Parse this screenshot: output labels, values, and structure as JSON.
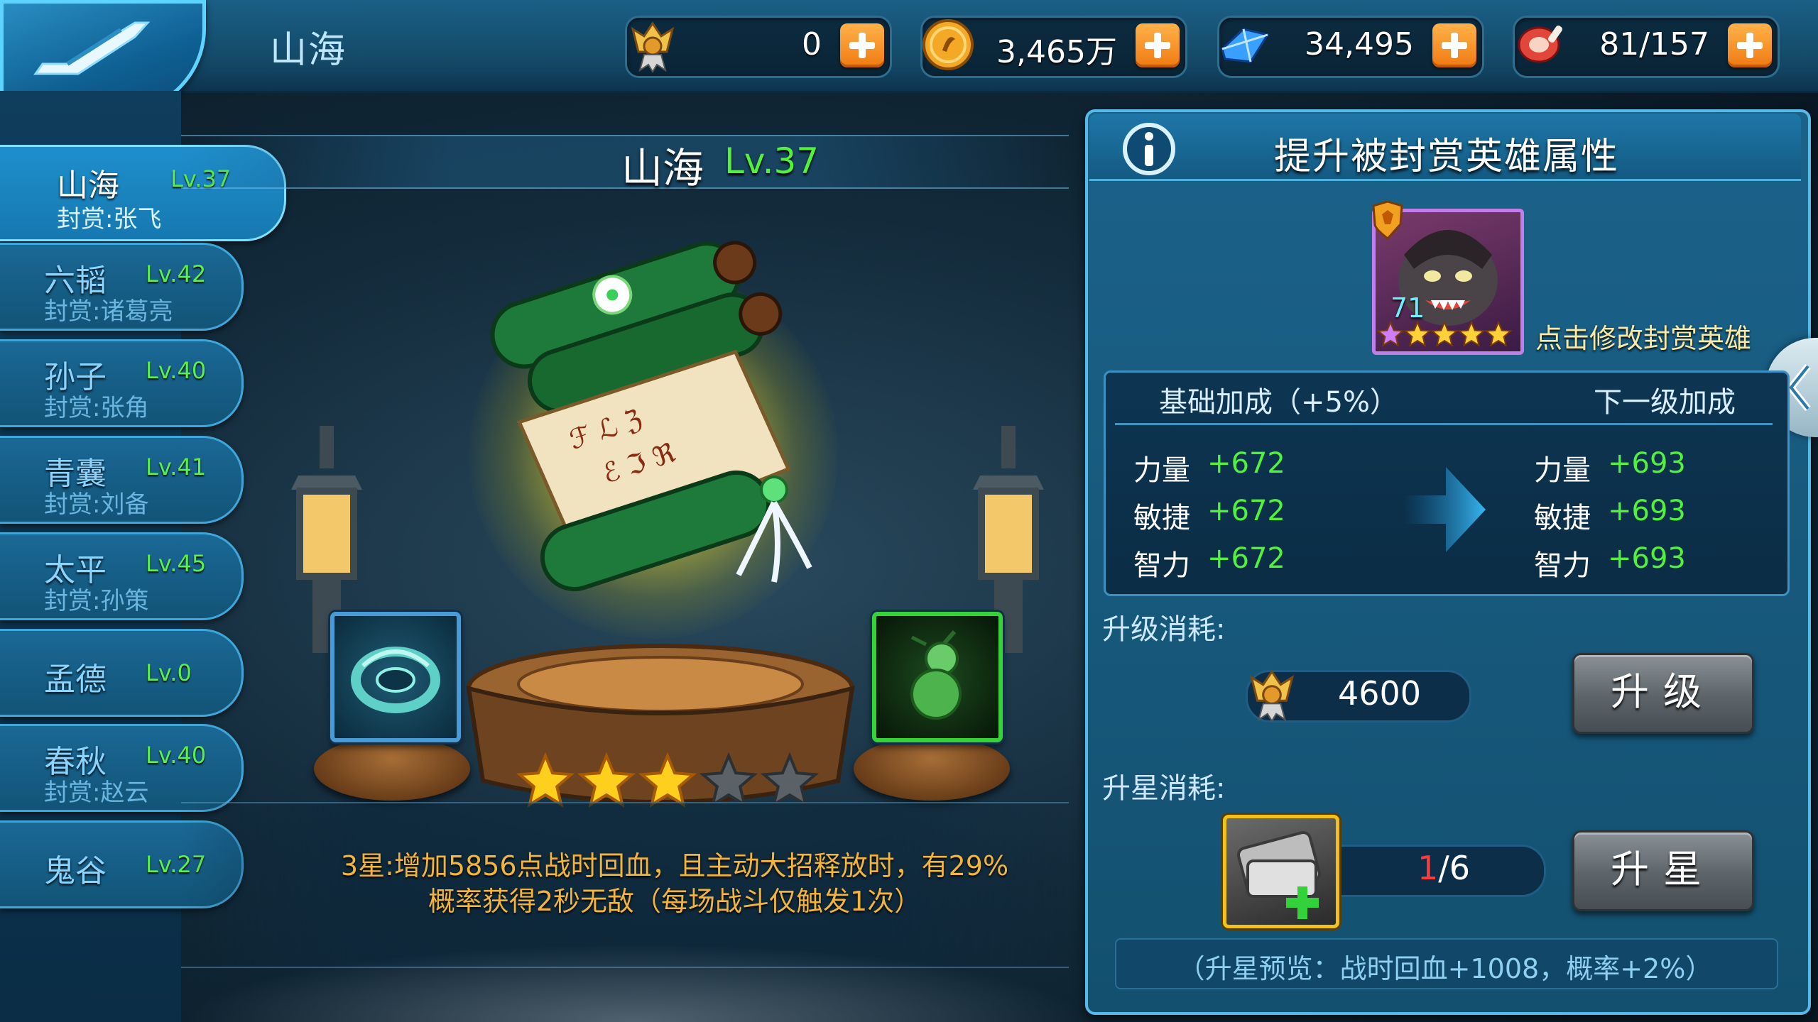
{
  "header": {
    "title": "山海",
    "resources": [
      {
        "icon": "medal-icon",
        "value": "0"
      },
      {
        "icon": "coin-icon",
        "value": "3,465万"
      },
      {
        "icon": "diamond-icon",
        "value": "34,495"
      },
      {
        "icon": "meat-icon",
        "value": "81/157"
      }
    ]
  },
  "sidebar": {
    "items": [
      {
        "name": "山海",
        "level": "Lv.37",
        "sub": "封赏:张飞",
        "active": true
      },
      {
        "name": "六韬",
        "level": "Lv.42",
        "sub": "封赏:诸葛亮"
      },
      {
        "name": "孙子",
        "level": "Lv.40",
        "sub": "封赏:张角"
      },
      {
        "name": "青囊",
        "level": "Lv.41",
        "sub": "封赏:刘备"
      },
      {
        "name": "太平",
        "level": "Lv.45",
        "sub": "封赏:孙策"
      },
      {
        "name": "孟德",
        "level": "Lv.0",
        "sub": ""
      },
      {
        "name": "春秋",
        "level": "Lv.40",
        "sub": "封赏:赵云"
      },
      {
        "name": "鬼谷",
        "level": "Lv.27",
        "sub": ""
      }
    ]
  },
  "book": {
    "name": "山海",
    "level": "Lv.37",
    "stars_filled": 3,
    "stars_total": 5,
    "skill_desc_line1": "3星:增加5856点战时回血，且主动大招释放时，有29%",
    "skill_desc_line2": "概率获得2秒无敌（每场战斗仅触发1次）"
  },
  "panel": {
    "title": "提升被封赏英雄属性",
    "hero_level": "71",
    "hero_stars": 5,
    "change_hero": "点击修改封赏英雄",
    "base_header": "基础加成（+5%）",
    "next_header": "下一级加成",
    "stats": [
      {
        "label": "力量",
        "base": "+672",
        "next": "+693"
      },
      {
        "label": "敏捷",
        "base": "+672",
        "next": "+693"
      },
      {
        "label": "智力",
        "base": "+672",
        "next": "+693"
      }
    ],
    "upgrade_cost_label": "升级消耗:",
    "upgrade_cost": "4600",
    "upgrade_button": "升级",
    "starup_cost_label": "升星消耗:",
    "starup_have": "1",
    "starup_need": "/6",
    "starup_button": "升星",
    "preview": "（升星预览：战时回血+1008，概率+2%）"
  },
  "colors": {
    "level_green": "#52f23c",
    "desc_orange": "#f2b43a",
    "panel_blue": "#1b628a"
  }
}
